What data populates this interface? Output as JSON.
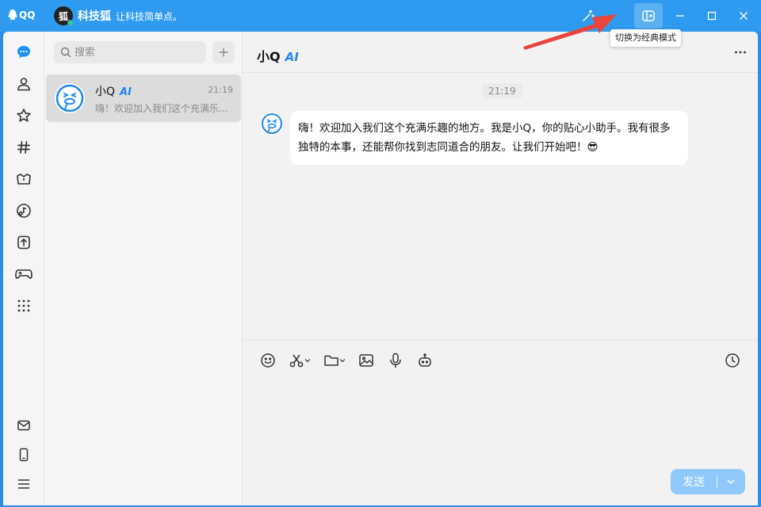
{
  "app": {
    "logo_text": "QQ"
  },
  "profile": {
    "avatar_text": "狐",
    "nickname": "科技狐",
    "signature": "让科技简单点。"
  },
  "titlebar": {
    "tooltip": "切换为经典模式"
  },
  "search": {
    "placeholder": "搜索"
  },
  "conversations": [
    {
      "name": "小Q",
      "tag": "AI",
      "time": "21:19",
      "preview": "嗨！欢迎加入我们这个充满乐..."
    }
  ],
  "chat": {
    "title": "小Q",
    "tag": "AI",
    "timestamp": "21:19",
    "messages": [
      {
        "text": "嗨！欢迎加入我们这个充满乐趣的地方。我是小Q，你的贴心小助手。我有很多独特的本事，还能帮你找到志同道合的朋友。让我们开始吧！😎"
      }
    ],
    "send_label": "发送"
  },
  "colors": {
    "accent": "#2f9bf0",
    "send_disabled": "#8fc9fb",
    "ai_tag": "#1e88f0",
    "arrow": "#e8453c"
  },
  "icons": {
    "sidebar_top": [
      "chat-icon",
      "contacts-icon",
      "favorites-icon",
      "channels-icon",
      "qzone-icon",
      "music-icon",
      "upload-icon",
      "game-icon",
      "apps-grid-icon"
    ],
    "sidebar_bottom": [
      "mail-icon",
      "phone-icon",
      "menu-icon"
    ],
    "toolbar": [
      "emoji-icon",
      "scissors-icon",
      "folder-icon",
      "image-icon",
      "microphone-icon",
      "robot-icon",
      "history-icon"
    ]
  }
}
